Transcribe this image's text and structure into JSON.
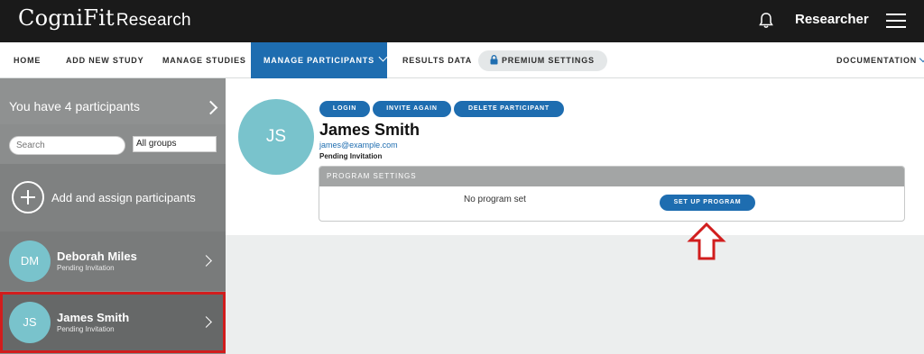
{
  "header": {
    "logo": "CogniFit",
    "logo_sub": "Research",
    "role": "Researcher"
  },
  "nav": {
    "items": [
      "HOME",
      "ADD NEW STUDY",
      "MANAGE STUDIES",
      "MANAGE PARTICIPANTS",
      "RESULTS DATA"
    ],
    "premium": "PREMIUM SETTINGS",
    "documentation": "DOCUMENTATION",
    "active_color": "#1e6db0"
  },
  "sidebar": {
    "count_text": "You have 4 participants",
    "search_placeholder": "Search",
    "group_select": "All groups",
    "add_label": "Add and assign participants",
    "participants": [
      {
        "initials": "DM",
        "name": "Deborah Miles",
        "status": "Pending Invitation"
      },
      {
        "initials": "JS",
        "name": "James Smith",
        "status": "Pending Invitation",
        "selected": true
      }
    ]
  },
  "detail": {
    "initials": "JS",
    "buttons": [
      "LOGIN",
      "INVITE AGAIN",
      "DELETE PARTICIPANT"
    ],
    "name": "James Smith",
    "email": "james@example.com",
    "status": "Pending Invitation",
    "program_settings": {
      "header": "PROGRAM SETTINGS",
      "empty_text": "No program set",
      "setup_button": "SET UP PROGRAM"
    }
  },
  "annotation": {
    "highlight_color": "#d11d1d",
    "arrow_icon": "up-arrow-outline"
  }
}
